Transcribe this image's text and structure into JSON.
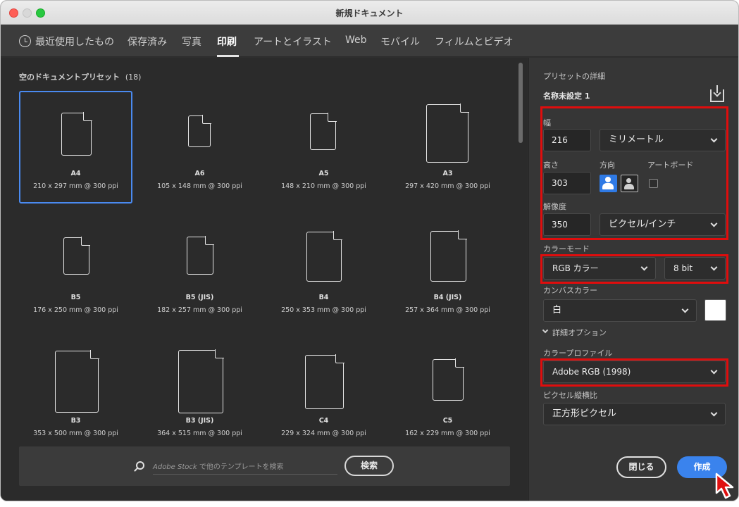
{
  "window": {
    "title": "新規ドキュメント"
  },
  "tabs": [
    {
      "label": "最近使用したもの",
      "icon": "clock-icon"
    },
    {
      "label": "保存済み"
    },
    {
      "label": "写真"
    },
    {
      "label": "印刷",
      "active": true
    },
    {
      "label": "アートとイラスト"
    },
    {
      "label": "Web"
    },
    {
      "label": "モバイル"
    },
    {
      "label": "フィルムとビデオ"
    }
  ],
  "presets_panel": {
    "title": "空のドキュメントプリセット",
    "count": "(18)",
    "presets": [
      {
        "name": "A4",
        "size": "210 x 297 mm @ 300 ppi",
        "selected": true
      },
      {
        "name": "A6",
        "size": "105 x 148 mm @ 300 ppi"
      },
      {
        "name": "A5",
        "size": "148 x 210 mm @ 300 ppi"
      },
      {
        "name": "A3",
        "size": "297 x 420 mm @ 300 ppi"
      },
      {
        "name": "B5",
        "size": "176 x 250 mm @ 300 ppi"
      },
      {
        "name": "B5 (JIS)",
        "size": "182 x 257 mm @ 300 ppi"
      },
      {
        "name": "B4",
        "size": "250 x 353 mm @ 300 ppi"
      },
      {
        "name": "B4 (JIS)",
        "size": "257 x 364 mm @ 300 ppi"
      },
      {
        "name": "B3",
        "size": "353 x 500 mm @ 300 ppi"
      },
      {
        "name": "B3 (JIS)",
        "size": "364 x 515 mm @ 300 ppi"
      },
      {
        "name": "C4",
        "size": "229 x 324 mm @ 300 ppi"
      },
      {
        "name": "C5",
        "size": "162 x 229 mm @ 300 ppi"
      }
    ],
    "search": {
      "placeholder_brand": "Adobe Stock",
      "placeholder_rest": " で他のテンプレートを検索",
      "button": "検索"
    }
  },
  "details": {
    "header": "プリセットの詳細",
    "doc_name": "名称未設定 1",
    "width_label": "幅",
    "width_value": "216",
    "unit": "ミリメートル",
    "height_label": "高さ",
    "height_value": "303",
    "orientation_label": "方向",
    "artboard_label": "アートボード",
    "resolution_label": "解像度",
    "resolution_value": "350",
    "resolution_unit": "ピクセル/インチ",
    "color_mode_label": "カラーモード",
    "color_mode": "RGB カラー",
    "bit_depth": "8 bit",
    "canvas_color_label": "カンバスカラー",
    "canvas_color": "白",
    "advanced_label": "詳細オプション",
    "profile_label": "カラープロファイル",
    "profile": "Adobe RGB (1998)",
    "pixel_aspect_label": "ピクセル縦横比",
    "pixel_aspect": "正方形ピクセル",
    "close_button": "閉じる",
    "create_button": "作成"
  },
  "colors": {
    "accent": "#3a83ed",
    "highlight": "#e00d0d",
    "panel_bg": "#363636",
    "grid_bg": "#2b2b2b"
  }
}
